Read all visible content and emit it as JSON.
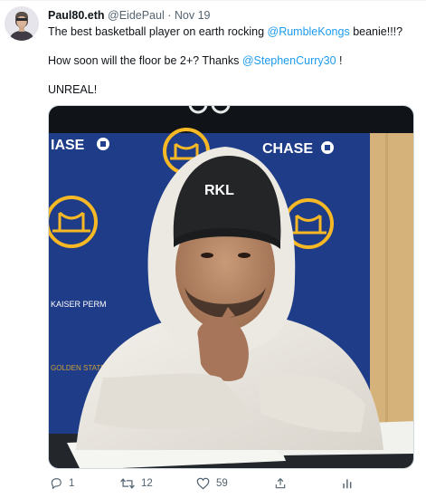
{
  "tweet": {
    "display_name": "Paul80.eth",
    "handle": "@EidePaul",
    "separator": "·",
    "date": "Nov 19",
    "line1_before": "The best basketball player on earth rocking ",
    "line1_mention": "@RumbleKongs",
    "line1_after": " beanie!!!?",
    "line2_before": "How soon will the floor be 2+? Thanks ",
    "line2_mention": "@StephenCurry30",
    "line2_after": " !",
    "line3": "UNREAL!"
  },
  "media": {
    "banner_left": "IASE",
    "banner_right": "CHASE",
    "beanie_logo": "RKL",
    "warriors_text": "GOLDEN STATE WARRIORS",
    "kaiser_text": "KAISER PERM"
  },
  "actions": {
    "reply_count": "1",
    "retweet_count": "12",
    "like_count": "59",
    "share_icon": "share-icon",
    "analytics_icon": "analytics-icon"
  },
  "colors": {
    "link": "#1d9bf0",
    "secondary_text": "#536471",
    "backdrop_blue": "#21408f"
  }
}
